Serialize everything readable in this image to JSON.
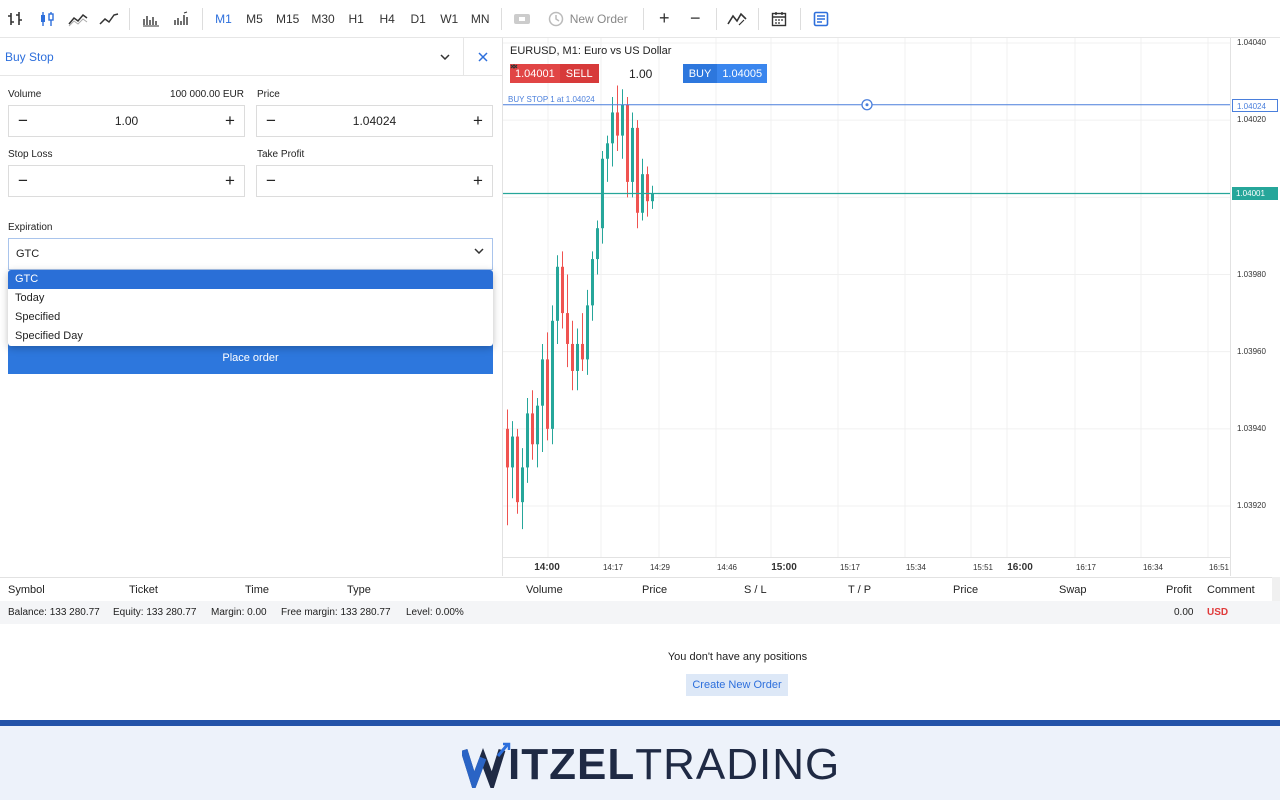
{
  "toolbar": {
    "icons": [
      "bar-chart-icon",
      "candlestick-icon",
      "area-chart-icon",
      "line-chart-icon",
      "volume-icon",
      "tick-volume-icon"
    ],
    "timeframes": [
      "M1",
      "M5",
      "M15",
      "M30",
      "H1",
      "H4",
      "D1",
      "W1",
      "MN"
    ],
    "active_timeframe": "M1",
    "new_order_label": "New Order",
    "zoom_in": "+",
    "zoom_out": "−"
  },
  "order_panel": {
    "title": "Buy Stop",
    "volume_label": "Volume",
    "volume_note": "100 000.00 EUR",
    "volume_value": "1.00",
    "price_label": "Price",
    "price_value": "1.04024",
    "stop_loss_label": "Stop Loss",
    "take_profit_label": "Take Profit",
    "expiration_label": "Expiration",
    "expiration_value": "GTC",
    "expiration_options": [
      "GTC",
      "Today",
      "Specified",
      "Specified Day"
    ],
    "place_order_label": "Place order",
    "minus": "−",
    "plus": "+"
  },
  "chart": {
    "title": "EURUSD, M1: Euro vs US Dollar",
    "sell_price": "1.04001",
    "sell_label": "SELL",
    "volume": "1.00",
    "buy_label": "BUY",
    "buy_price": "1.04005",
    "buy_stop_label": "BUY STOP 1 at 1.04024",
    "bid_tag": "1.04001",
    "order_tag": "1.04024",
    "price_ticks": [
      "1.04040",
      "1.04020",
      "1.03980",
      "1.03960",
      "1.03940",
      "1.03920"
    ],
    "time_ticks": [
      {
        "label": "14:00",
        "bold": true
      },
      {
        "label": "14:17",
        "bold": false
      },
      {
        "label": "14:29",
        "bold": false
      },
      {
        "label": "14:46",
        "bold": false
      },
      {
        "label": "15:00",
        "bold": true
      },
      {
        "label": "15:17",
        "bold": false
      },
      {
        "label": "15:34",
        "bold": false
      },
      {
        "label": "15:51",
        "bold": false
      },
      {
        "label": "16:00",
        "bold": true
      },
      {
        "label": "16:17",
        "bold": false
      },
      {
        "label": "16:34",
        "bold": false
      },
      {
        "label": "16:51",
        "bold": false
      }
    ],
    "colors": {
      "up": "#26a69a",
      "down": "#ef5350",
      "order_line": "#4a7fdc",
      "bid_line": "#26a69a"
    }
  },
  "chart_data": {
    "type": "candlestick",
    "title": "EURUSD, M1: Euro vs US Dollar",
    "ylim": [
      1.0391,
      1.04043
    ],
    "candles": [
      {
        "o": 1.0394,
        "h": 1.03945,
        "l": 1.03915,
        "c": 1.0393
      },
      {
        "o": 1.0393,
        "h": 1.03942,
        "l": 1.03922,
        "c": 1.03938
      },
      {
        "o": 1.03938,
        "h": 1.0394,
        "l": 1.03918,
        "c": 1.03921
      },
      {
        "o": 1.03921,
        "h": 1.03935,
        "l": 1.03914,
        "c": 1.0393
      },
      {
        "o": 1.0393,
        "h": 1.03948,
        "l": 1.03926,
        "c": 1.03944
      },
      {
        "o": 1.03944,
        "h": 1.0395,
        "l": 1.03932,
        "c": 1.03936
      },
      {
        "o": 1.03936,
        "h": 1.03948,
        "l": 1.0393,
        "c": 1.03946
      },
      {
        "o": 1.03946,
        "h": 1.03962,
        "l": 1.03934,
        "c": 1.03958
      },
      {
        "o": 1.03958,
        "h": 1.03965,
        "l": 1.03937,
        "c": 1.0394
      },
      {
        "o": 1.0394,
        "h": 1.03972,
        "l": 1.03936,
        "c": 1.03968
      },
      {
        "o": 1.03968,
        "h": 1.03985,
        "l": 1.03962,
        "c": 1.03982
      },
      {
        "o": 1.03982,
        "h": 1.03986,
        "l": 1.03966,
        "c": 1.0397
      },
      {
        "o": 1.0397,
        "h": 1.0398,
        "l": 1.03956,
        "c": 1.03962
      },
      {
        "o": 1.03962,
        "h": 1.03968,
        "l": 1.0395,
        "c": 1.03955
      },
      {
        "o": 1.03955,
        "h": 1.03966,
        "l": 1.0395,
        "c": 1.03962
      },
      {
        "o": 1.03962,
        "h": 1.0397,
        "l": 1.03955,
        "c": 1.03958
      },
      {
        "o": 1.03958,
        "h": 1.03976,
        "l": 1.03954,
        "c": 1.03972
      },
      {
        "o": 1.03972,
        "h": 1.03986,
        "l": 1.03968,
        "c": 1.03984
      },
      {
        "o": 1.03984,
        "h": 1.03994,
        "l": 1.0398,
        "c": 1.03992
      },
      {
        "o": 1.03992,
        "h": 1.04012,
        "l": 1.03988,
        "c": 1.0401
      },
      {
        "o": 1.0401,
        "h": 1.04016,
        "l": 1.04004,
        "c": 1.04014
      },
      {
        "o": 1.04014,
        "h": 1.04026,
        "l": 1.04008,
        "c": 1.04022
      },
      {
        "o": 1.04022,
        "h": 1.04029,
        "l": 1.04012,
        "c": 1.04016
      },
      {
        "o": 1.04016,
        "h": 1.04028,
        "l": 1.0401,
        "c": 1.04024
      },
      {
        "o": 1.04024,
        "h": 1.04026,
        "l": 1.04,
        "c": 1.04004
      },
      {
        "o": 1.04004,
        "h": 1.04022,
        "l": 1.04,
        "c": 1.04018
      },
      {
        "o": 1.04018,
        "h": 1.0402,
        "l": 1.03992,
        "c": 1.03996
      },
      {
        "o": 1.03996,
        "h": 1.0401,
        "l": 1.03994,
        "c": 1.04006
      },
      {
        "o": 1.04006,
        "h": 1.04008,
        "l": 1.03995,
        "c": 1.03999
      },
      {
        "o": 1.03999,
        "h": 1.04003,
        "l": 1.03997,
        "c": 1.04001
      }
    ],
    "order_price": 1.04024,
    "bid_price": 1.04001
  },
  "table": {
    "headers": [
      "Symbol",
      "Ticket",
      "Time",
      "Type",
      "Volume",
      "Price",
      "S / L",
      "T / P",
      "Price",
      "Swap",
      "Profit",
      "Comment"
    ],
    "balance": "Balance: 133 280.77",
    "equity": "Equity: 133 280.77",
    "margin": "Margin: 0.00",
    "free_margin": "Free margin: 133 280.77",
    "level": "Level: 0.00%",
    "profit": "0.00",
    "currency": "USD",
    "empty_message": "You don't have any positions",
    "create_label": "Create New Order"
  },
  "brand": {
    "bold": "ITZEL",
    "light": "TRADING"
  }
}
